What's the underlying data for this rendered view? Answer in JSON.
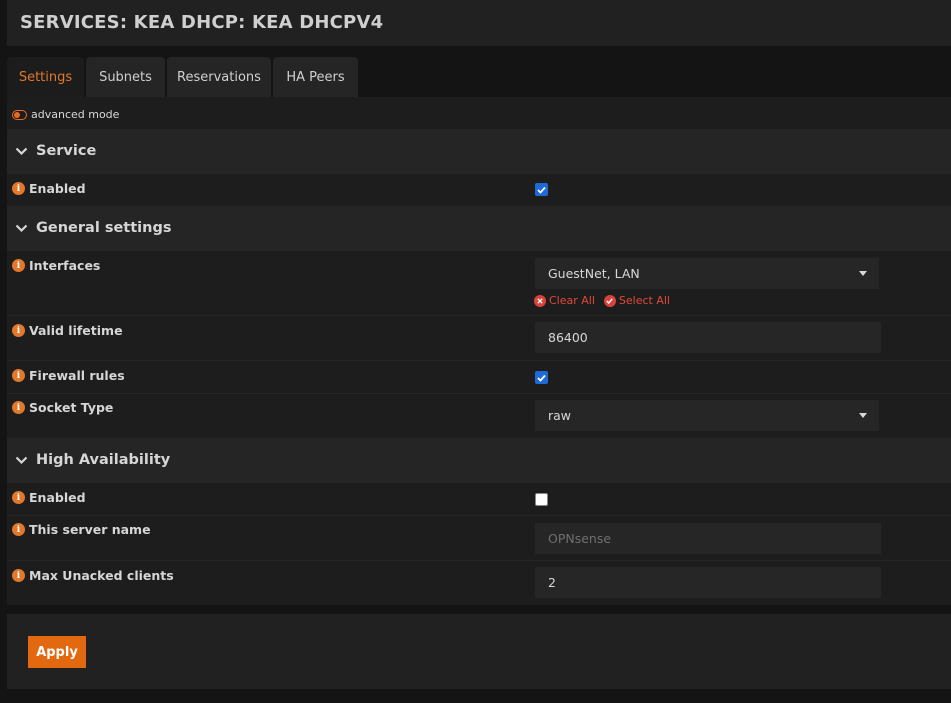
{
  "header": {
    "title": "SERVICES: KEA DHCP: KEA DHCPV4"
  },
  "tabs": [
    {
      "label": "Settings"
    },
    {
      "label": "Subnets"
    },
    {
      "label": "Reservations"
    },
    {
      "label": "HA Peers"
    }
  ],
  "advanced_mode": {
    "label": "advanced mode"
  },
  "sections": {
    "service": {
      "title": "Service"
    },
    "general": {
      "title": "General settings"
    },
    "ha": {
      "title": "High Availability"
    }
  },
  "fields": {
    "service_enabled": {
      "label": "Enabled",
      "checked": true
    },
    "interfaces": {
      "label": "Interfaces",
      "value": "GuestNet, LAN",
      "clear_all": "Clear All",
      "select_all": "Select All"
    },
    "valid_lifetime": {
      "label": "Valid lifetime",
      "value": "86400"
    },
    "firewall_rules": {
      "label": "Firewall rules",
      "checked": true
    },
    "socket_type": {
      "label": "Socket Type",
      "value": "raw"
    },
    "ha_enabled": {
      "label": "Enabled",
      "checked": false
    },
    "server_name": {
      "label": "This server name",
      "placeholder": "OPNsense"
    },
    "max_unacked": {
      "label": "Max Unacked clients",
      "value": "2"
    }
  },
  "footer": {
    "apply_label": "Apply"
  },
  "colors": {
    "accent": "#e2782c",
    "checkbox": "#1e6ad6",
    "link_red": "#d9443a"
  }
}
